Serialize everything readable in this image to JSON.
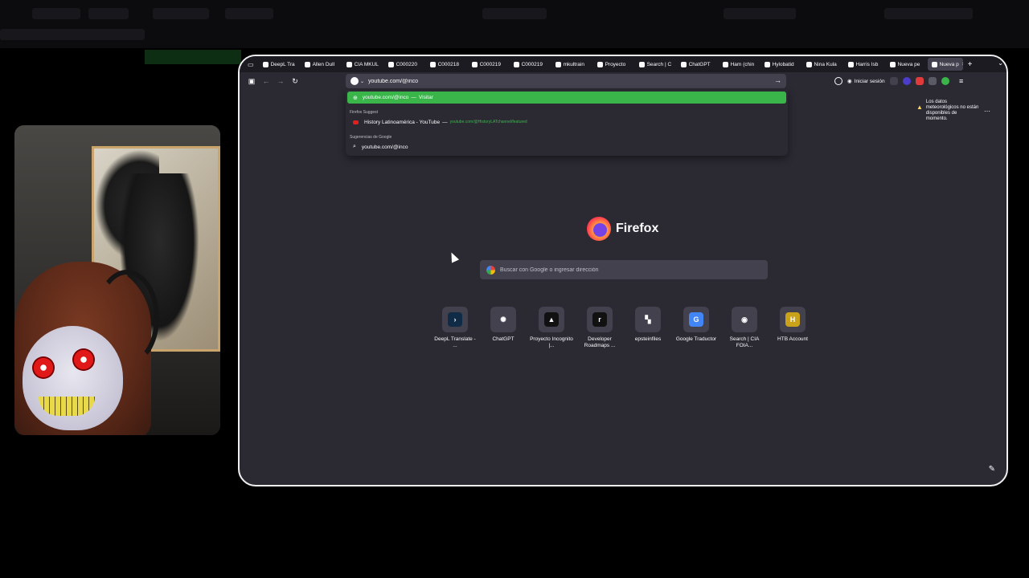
{
  "tabs": [
    {
      "label": "DeepL Tra",
      "icon": "deepl-icon"
    },
    {
      "label": "Allen Dull",
      "icon": "wiki-icon"
    },
    {
      "label": "CIA MKUL",
      "icon": "cia-icon"
    },
    {
      "label": "C000220",
      "icon": "document-icon"
    },
    {
      "label": "C000218",
      "icon": "document-icon"
    },
    {
      "label": "C000219",
      "icon": "document-icon"
    },
    {
      "label": "C000219",
      "icon": "document-icon"
    },
    {
      "label": "mkultrain",
      "icon": "document-icon"
    },
    {
      "label": "Proyecto",
      "icon": "proyecto-icon"
    },
    {
      "label": "Search | C",
      "icon": "search-icon"
    },
    {
      "label": "ChatGPT",
      "icon": "chatgpt-icon"
    },
    {
      "label": "Ham (chin",
      "icon": "wiki-icon"
    },
    {
      "label": "Hylobatid",
      "icon": "wiki-icon"
    },
    {
      "label": "Nina Kula",
      "icon": "wiki-icon"
    },
    {
      "label": "Harris Isb",
      "icon": "wiki-icon"
    },
    {
      "label": "Nueva pe",
      "icon": "firefox-icon"
    },
    {
      "label": "Nueva p",
      "icon": "firefox-icon",
      "active": true
    }
  ],
  "urlbar": {
    "value": "youtube.com/@inco"
  },
  "signin_label": "Iniciar sesión",
  "dropdown": {
    "heuristic": {
      "url": "youtube.com/@inco",
      "action": "Visitar"
    },
    "firefox_suggest_label": "Firefox Suggest",
    "history": {
      "title": "History Latinoamérica - YouTube",
      "url": "youtube.com/@HistoryLATchannel/featured"
    },
    "google_label": "Sugerencias de Google",
    "google_suggestion": "youtube.com/@inco"
  },
  "weather": {
    "text": "Los datos meteorológicos no están disponibles de momento."
  },
  "brand": "Firefox",
  "search": {
    "placeholder": "Buscar con Google o ingresar dirección"
  },
  "shortcuts": [
    {
      "label": "DeepL Translate - ...",
      "icon": "deepl-icon",
      "color": "#0f2b46",
      "glyph": "›"
    },
    {
      "label": "ChatGPT",
      "icon": "chatgpt-icon",
      "color": "#42414d",
      "glyph": "✺"
    },
    {
      "label": "Proyecto Incognito |...",
      "icon": "proyecto-icon",
      "color": "#111111",
      "glyph": "▲"
    },
    {
      "label": "Developer Roadmaps ...",
      "icon": "roadmap-icon",
      "color": "#111111",
      "glyph": "r"
    },
    {
      "label": "epsteinfiles",
      "icon": "epstein-icon",
      "color": "#42414d",
      "glyph": "▚"
    },
    {
      "label": "Google Traductor",
      "icon": "translate-icon",
      "color": "#4285f4",
      "glyph": "G"
    },
    {
      "label": "Search | CIA FOIA...",
      "icon": "cia-icon",
      "color": "#42414d",
      "glyph": "◉"
    },
    {
      "label": "HTB Account",
      "icon": "htb-icon",
      "color": "#c9a21a",
      "glyph": "H"
    }
  ]
}
